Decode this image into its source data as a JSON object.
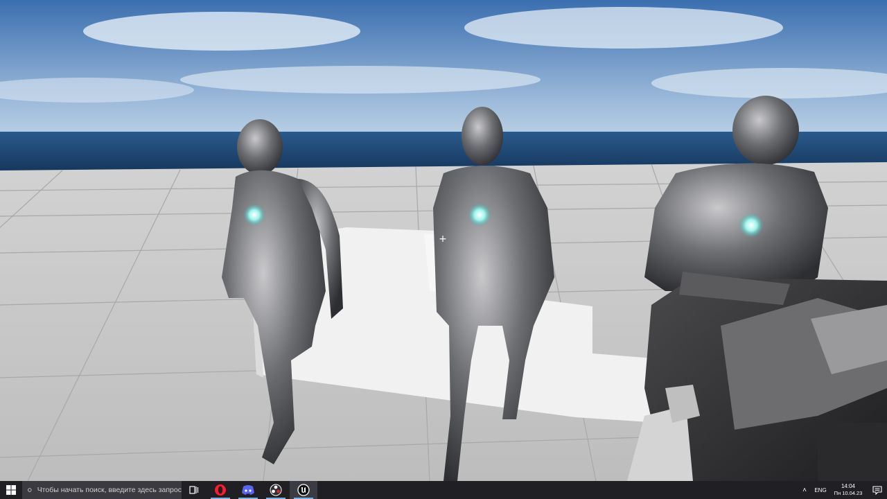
{
  "viewport": {
    "sky_top": "#3b6fb0",
    "sky_bottom": "#bcd2e6",
    "horizon": "#1e4a7a",
    "floor_light": "#c8c8c8",
    "floor_dark": "#a9a9a9",
    "crosshair_glyph": "+",
    "character_glow": "#9ff5ee",
    "character_count": 3
  },
  "taskbar": {
    "search_placeholder": "Чтобы начать поиск, введите здесь запрос",
    "apps": [
      {
        "name": "opera",
        "color": "#ff1b2d"
      },
      {
        "name": "discord",
        "color": "#5865f2"
      },
      {
        "name": "obs",
        "color": "#302e31"
      },
      {
        "name": "unreal-engine",
        "color": "#111111"
      }
    ],
    "tray": {
      "chevron": "˄",
      "language": "ENG",
      "time": "14:04",
      "date": "Пн 10.04.23"
    }
  }
}
